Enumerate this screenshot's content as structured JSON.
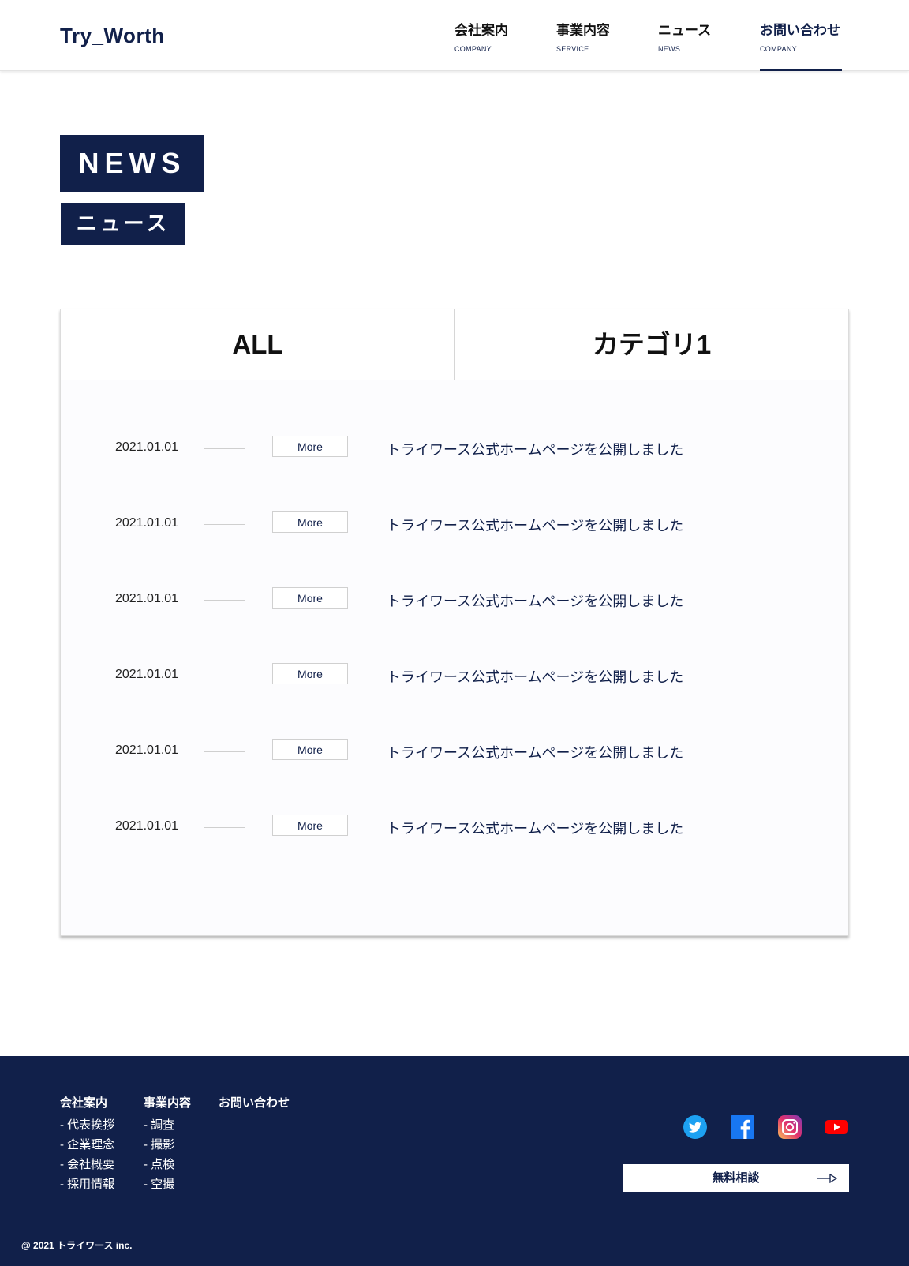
{
  "header": {
    "logo": "Try_Worth",
    "nav": [
      {
        "jp": "会社案内",
        "en": "COMPANY"
      },
      {
        "jp": "事業内容",
        "en": "SERVICE"
      },
      {
        "jp": "ニュース",
        "en": "NEWS"
      },
      {
        "jp": "お問い合わせ",
        "en": "COMPANY"
      }
    ]
  },
  "hero": {
    "title_en": "NEWS",
    "title_jp": "ニュース"
  },
  "news": {
    "tabs": [
      "ALL",
      "カテゴリ1"
    ],
    "more_label": "More",
    "items": [
      {
        "date": "2021.01.01",
        "text": "トライワース公式ホームページを公開しました"
      },
      {
        "date": "2021.01.01",
        "text": "トライワース公式ホームページを公開しました"
      },
      {
        "date": "2021.01.01",
        "text": "トライワース公式ホームページを公開しました"
      },
      {
        "date": "2021.01.01",
        "text": "トライワース公式ホームページを公開しました"
      },
      {
        "date": "2021.01.01",
        "text": "トライワース公式ホームページを公開しました"
      },
      {
        "date": "2021.01.01",
        "text": "トライワース公式ホームページを公開しました"
      }
    ]
  },
  "footer": {
    "columns": [
      {
        "title": "会社案内",
        "links": [
          "- 代表挨拶",
          "- 企業理念",
          "- 会社概要",
          "- 採用情報"
        ]
      },
      {
        "title": "事業内容",
        "links": [
          "- 調査",
          "- 撮影",
          "- 点検",
          "- 空撮"
        ]
      },
      {
        "title": "お問い合わせ",
        "links": []
      }
    ],
    "social_icons": [
      "twitter-icon",
      "facebook-icon",
      "instagram-icon",
      "youtube-icon"
    ],
    "cta_label": "無料相談",
    "copyright": "@ 2021 トライワース inc."
  },
  "colors": {
    "navy": "#11204a",
    "twitter": "#1da1f2",
    "facebook": "#1877f2",
    "youtube": "#ff0000"
  }
}
